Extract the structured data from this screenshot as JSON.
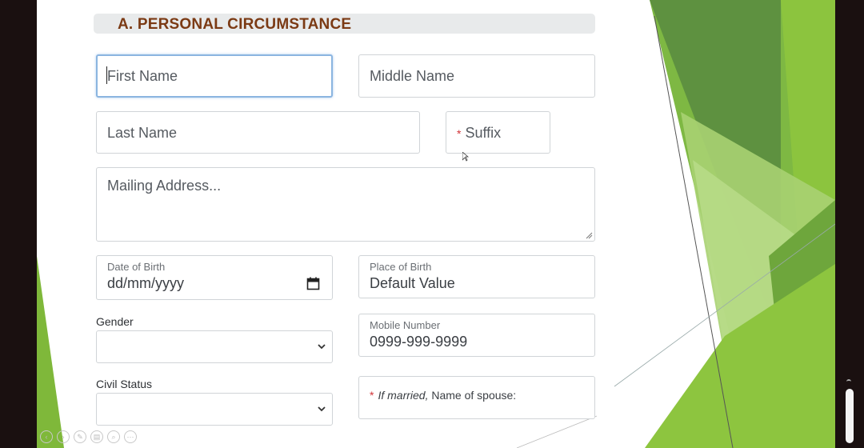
{
  "section": {
    "title": "A. PERSONAL CIRCUMSTANCE"
  },
  "fields": {
    "first_name": {
      "placeholder": "First Name"
    },
    "middle_name": {
      "placeholder": "Middle Name"
    },
    "last_name": {
      "placeholder": "Last Name"
    },
    "suffix": {
      "required_mark": "*",
      "placeholder": "Suffix"
    },
    "mailing_address": {
      "placeholder": "Mailing Address..."
    },
    "date_of_birth": {
      "label": "Date of Birth",
      "value": "dd/mm/yyyy"
    },
    "place_of_birth": {
      "label": "Place of Birth",
      "value": "Default Value"
    },
    "gender": {
      "label": "Gender",
      "value": ""
    },
    "mobile_number": {
      "label": "Mobile Number",
      "value": "0999-999-9999"
    },
    "civil_status": {
      "label": "Civil Status",
      "value": ""
    },
    "spouse_name": {
      "required_mark": "*",
      "italic_prefix": "If married,",
      "text": "Name of spouse:"
    }
  },
  "icons": {
    "calendar": "calendar-icon",
    "dropdown": "chevron-down-icon",
    "resize": "resize-grip-icon"
  },
  "colors": {
    "title": "#7b3a14",
    "focus_border": "#8bb5e0",
    "required": "#d13438",
    "green_dark": "#5c8c3a",
    "green_light": "#9ccb4a"
  }
}
